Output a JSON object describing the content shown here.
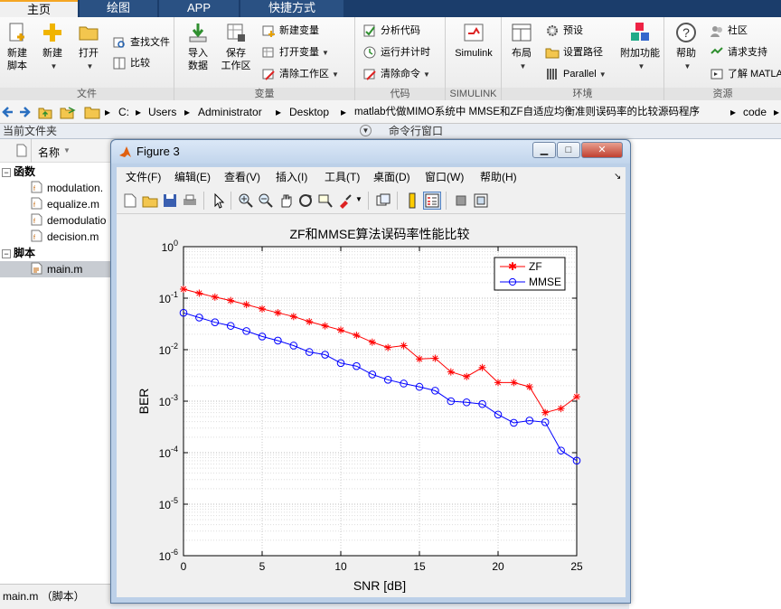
{
  "tabs": [
    "主页",
    "绘图",
    "APP",
    "快捷方式"
  ],
  "ribbon": {
    "groups": [
      "文件",
      "变量",
      "代码",
      "SIMULINK",
      "环境",
      "资源"
    ],
    "new_script": "新建\n脚本",
    "new_script_l1": "新建",
    "new_script_l2": "脚本",
    "new_label": "新建",
    "open_label": "打开",
    "find_files": "查找文件",
    "compare": "比较",
    "import_l1": "导入",
    "import_l2": "数据",
    "save_ws_l1": "保存",
    "save_ws_l2": "工作区",
    "new_var": "新建变量",
    "open_var": "打开变量",
    "clear_ws": "清除工作区",
    "analyze_code": "分析代码",
    "run_time": "运行并计时",
    "clear_cmd": "清除命令",
    "simulink": "Simulink",
    "layout": "布局",
    "preferences": "预设",
    "set_path": "设置路径",
    "parallel": "Parallel",
    "addons": "附加功能",
    "help": "帮助",
    "community": "社区",
    "request_support": "请求支持",
    "learn_matlab": "了解 MATLA"
  },
  "address": {
    "crumbs": [
      "C:",
      "Users",
      "Administrator",
      "Desktop",
      "matlab代做MIMO系统中 MMSE和ZF自适应均衡准则误码率的比较源码程序",
      "code"
    ]
  },
  "left_panel": {
    "header": "当前文件夹",
    "name_col": "名称",
    "group_functions": "函数",
    "functions": [
      "modulation.",
      "equalize.m",
      "demodulatio",
      "decision.m"
    ],
    "group_scripts": "脚本",
    "scripts": [
      "main.m"
    ],
    "status": "main.m （脚本）"
  },
  "command_window": {
    "header": "命令行窗口"
  },
  "figure": {
    "title": "Figure 3",
    "menus": [
      "文件(F)",
      "编辑(E)",
      "查看(V)",
      "插入(I)",
      "工具(T)",
      "桌面(D)",
      "窗口(W)",
      "帮助(H)"
    ]
  },
  "chart_data": {
    "type": "line",
    "title": "ZF和MMSE算法误码率性能比较",
    "xlabel": "SNR [dB]",
    "ylabel": "BER",
    "xlim": [
      0,
      25
    ],
    "ylim": [
      1e-06,
      1
    ],
    "yscale": "log",
    "grid": true,
    "legend_position": "top-right",
    "x_ticks": [
      "0",
      "5",
      "10",
      "15",
      "20",
      "25"
    ],
    "y_tick_exponents": [
      "0",
      "-1",
      "-2",
      "-3",
      "-4",
      "-5",
      "-6"
    ],
    "x": [
      0,
      1,
      2,
      3,
      4,
      5,
      6,
      7,
      8,
      9,
      10,
      11,
      12,
      13,
      14,
      15,
      16,
      17,
      18,
      19,
      20,
      21,
      22,
      23,
      24,
      25
    ],
    "series": [
      {
        "name": "ZF",
        "color": "#ff0000",
        "marker": "star",
        "values": [
          0.15,
          0.125,
          0.105,
          0.09,
          0.075,
          0.062,
          0.052,
          0.044,
          0.035,
          0.029,
          0.024,
          0.019,
          0.014,
          0.011,
          0.012,
          0.0066,
          0.0068,
          0.0037,
          0.003,
          0.0045,
          0.0023,
          0.0023,
          0.0019,
          0.0006,
          0.00072,
          0.00122
        ]
      },
      {
        "name": "MMSE",
        "color": "#0000ff",
        "marker": "circle",
        "values": [
          0.052,
          0.042,
          0.034,
          0.029,
          0.023,
          0.018,
          0.015,
          0.012,
          0.009,
          0.008,
          0.0055,
          0.0048,
          0.0033,
          0.0026,
          0.0022,
          0.0019,
          0.0016,
          0.001,
          0.00095,
          0.00088,
          0.00055,
          0.00038,
          0.00042,
          0.00039,
          0.00011,
          7e-05
        ]
      }
    ]
  },
  "colors": {
    "tabbar": "#1b3d6b",
    "accent": "#f5a623"
  }
}
